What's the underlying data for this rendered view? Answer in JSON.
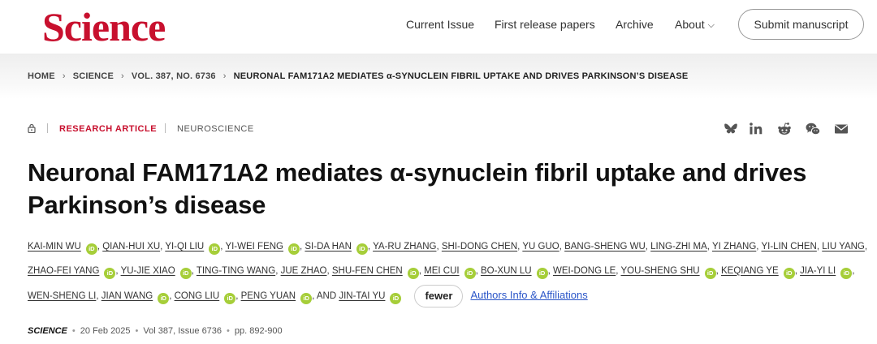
{
  "header": {
    "logo": "Science",
    "nav": {
      "current_issue": "Current Issue",
      "first_release": "First release papers",
      "archive": "Archive",
      "about": "About"
    },
    "submit": "Submit manuscript"
  },
  "breadcrumb": [
    "HOME",
    "SCIENCE",
    "VOL. 387, NO. 6736",
    "NEURONAL FAM171A2 MEDIATES α-SYNUCLEIN FIBRIL UPTAKE AND DRIVES PARKINSON’S DISEASE"
  ],
  "article": {
    "type": "RESEARCH ARTICLE",
    "subject": "NEUROSCIENCE",
    "title": "Neuronal FAM171A2 mediates α-synuclein fibril uptake and drives Parkinson’s disease",
    "share_icons": [
      "bluesky-icon",
      "linkedin-icon",
      "reddit-icon",
      "wechat-icon",
      "email-icon"
    ],
    "orcid_badge": "iD",
    "authors": [
      {
        "name": "KAI-MIN WU",
        "orcid": true
      },
      {
        "name": "QIAN-HUI XU",
        "orcid": false
      },
      {
        "name": "YI-QI LIU",
        "orcid": true
      },
      {
        "name": "YI-WEI FENG",
        "orcid": true
      },
      {
        "name": "SI-DA HAN",
        "orcid": true
      },
      {
        "name": "YA-RU ZHANG",
        "orcid": false
      },
      {
        "name": "SHI-DONG CHEN",
        "orcid": false
      },
      {
        "name": "YU GUO",
        "orcid": false
      },
      {
        "name": "BANG-SHENG WU",
        "orcid": false
      },
      {
        "name": "LING-ZHI MA",
        "orcid": false
      },
      {
        "name": "YI ZHANG",
        "orcid": false
      },
      {
        "name": "YI-LIN CHEN",
        "orcid": false
      },
      {
        "name": "LIU YANG",
        "orcid": false
      },
      {
        "name": "ZHAO-FEI YANG",
        "orcid": true
      },
      {
        "name": "YU-JIE XIAO",
        "orcid": true
      },
      {
        "name": "TING-TING WANG",
        "orcid": false
      },
      {
        "name": "JUE ZHAO",
        "orcid": false
      },
      {
        "name": "SHU-FEN CHEN",
        "orcid": true
      },
      {
        "name": "MEI CUI",
        "orcid": true
      },
      {
        "name": "BO-XUN LU",
        "orcid": true
      },
      {
        "name": "WEI-DONG LE",
        "orcid": false
      },
      {
        "name": "YOU-SHENG SHU",
        "orcid": true
      },
      {
        "name": "KEQIANG YE",
        "orcid": true
      },
      {
        "name": "JIA-YI LI",
        "orcid": true
      },
      {
        "name": "WEN-SHENG LI",
        "orcid": false
      },
      {
        "name": "JIAN WANG",
        "orcid": true
      },
      {
        "name": "CONG LIU",
        "orcid": true
      },
      {
        "name": "PENG YUAN",
        "orcid": true
      },
      {
        "name": "JIN-TAI YU",
        "orcid": true
      }
    ],
    "and_text": "AND",
    "fewer": "fewer",
    "affiliations_link": "Authors Info & Affiliations",
    "citation": {
      "journal": "SCIENCE",
      "date": "20 Feb 2025",
      "volume_issue": "Vol 387, Issue 6736",
      "pages": "pp. 892-900"
    }
  },
  "colors": {
    "brand": "#c8102e",
    "orcid": "#a6ce39",
    "link": "#2a55c8"
  }
}
